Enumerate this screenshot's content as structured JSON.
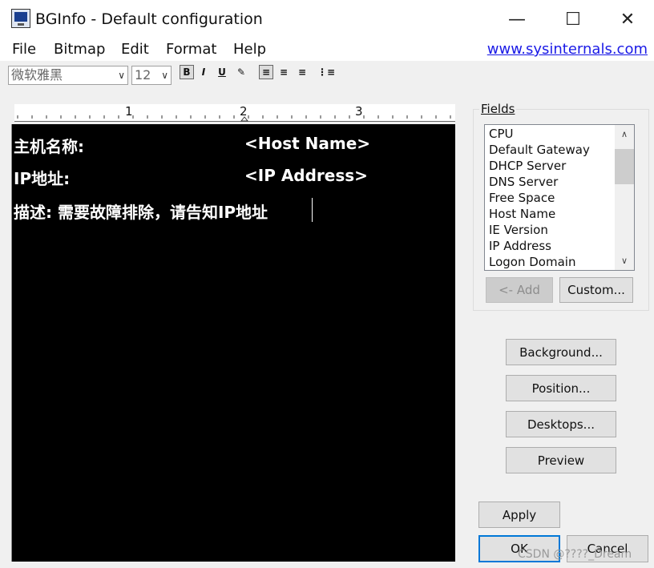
{
  "window": {
    "title": "BGInfo - Default configuration",
    "controls": {
      "minimize": "—",
      "maximize": "☐",
      "close": "✕"
    }
  },
  "menu": {
    "items": [
      "File",
      "Bitmap",
      "Edit",
      "Format",
      "Help"
    ],
    "link": "www.sysinternals.com"
  },
  "toolbar": {
    "font_name": "微软雅黑",
    "font_size": "12",
    "format_buttons": [
      {
        "name": "bold",
        "glyph": "B"
      },
      {
        "name": "italic",
        "glyph": "I"
      },
      {
        "name": "underline",
        "glyph": "U"
      },
      {
        "name": "color",
        "glyph": "✎"
      },
      {
        "name": "align-left",
        "glyph": "≡"
      },
      {
        "name": "align-center",
        "glyph": "≡"
      },
      {
        "name": "align-right",
        "glyph": "≡"
      },
      {
        "name": "bullets",
        "glyph": "⋮≡"
      }
    ]
  },
  "ruler": {
    "marks": [
      "1",
      "2",
      "3"
    ]
  },
  "editor": {
    "lines": [
      {
        "label": "主机名称:",
        "value": "<Host Name>"
      },
      {
        "label": "IP地址:",
        "value": "<IP Address>"
      },
      {
        "label": "描述: 需要故障排除，请告知IP地址",
        "value": ""
      }
    ]
  },
  "fields": {
    "label": "Fields",
    "items": [
      "CPU",
      "Default Gateway",
      "DHCP Server",
      "DNS Server",
      "Free Space",
      "Host Name",
      "IE Version",
      "IP Address",
      "Logon Domain"
    ],
    "add_button": "<- Add",
    "custom_button": "Custom..."
  },
  "buttons": {
    "background": "Background...",
    "position": "Position...",
    "desktops": "Desktops...",
    "preview": "Preview",
    "apply": "Apply",
    "ok": "OK",
    "cancel": "Cancel"
  },
  "watermark": "CSDN @????_Dream"
}
